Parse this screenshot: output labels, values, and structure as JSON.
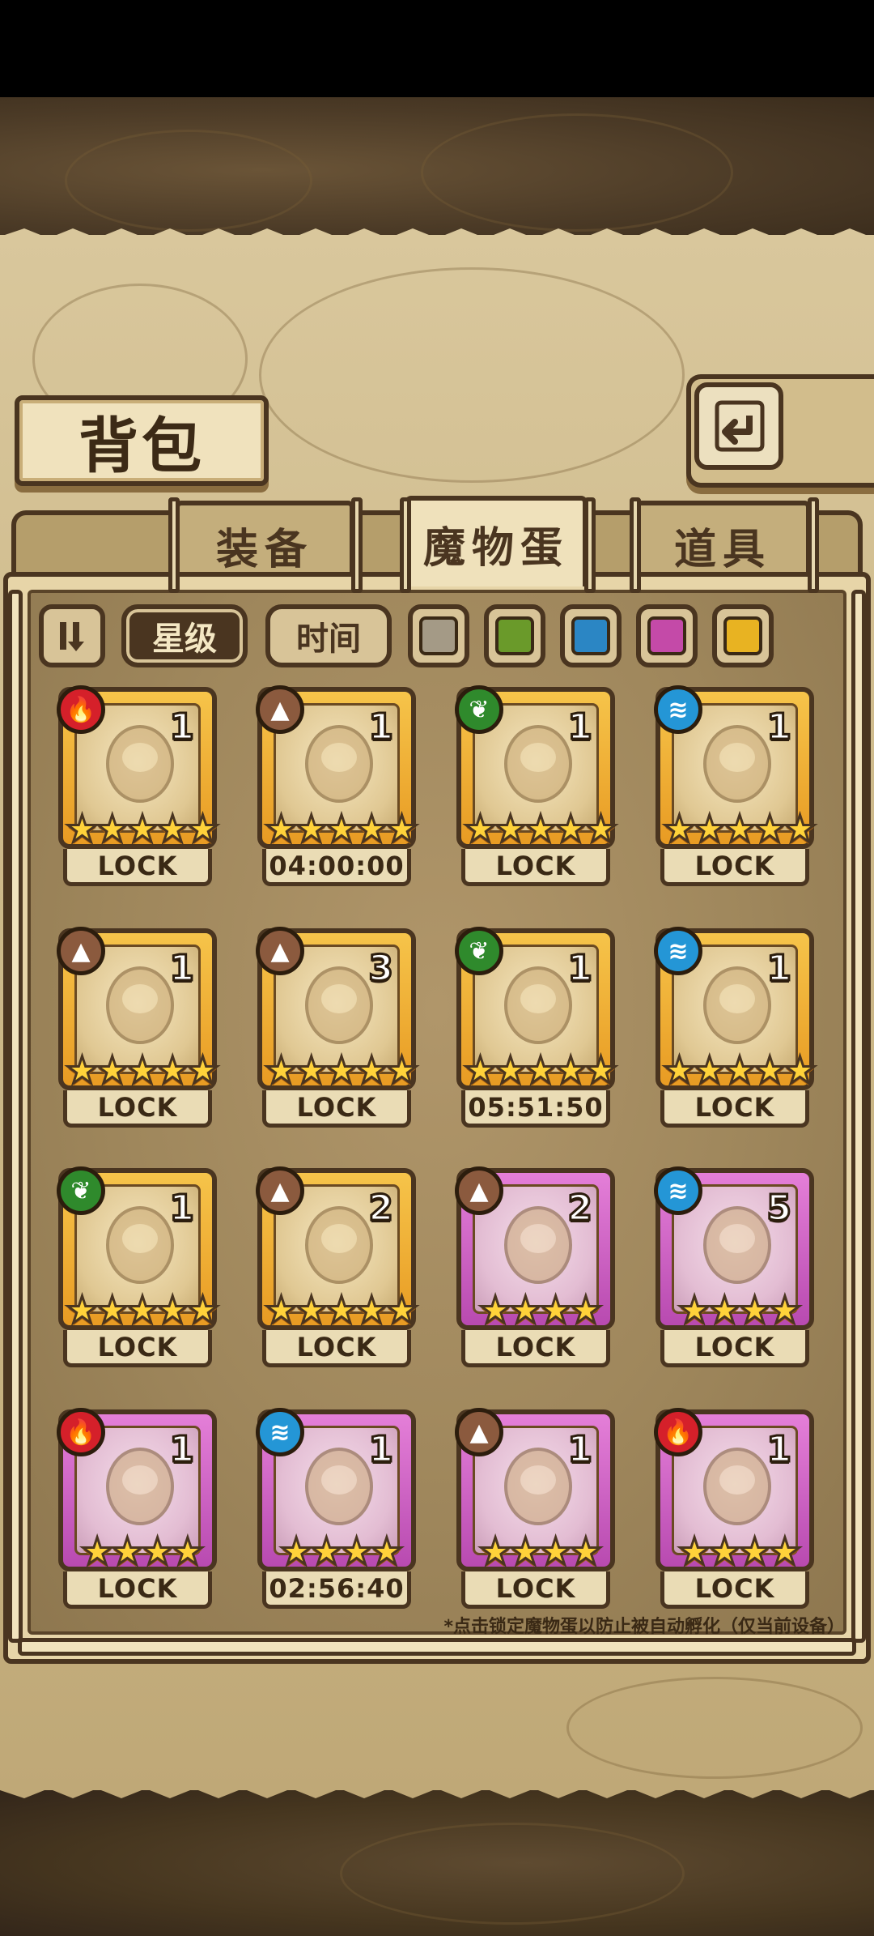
{
  "title": "背包",
  "tabs": [
    {
      "label": "装备",
      "active": false
    },
    {
      "label": "魔物蛋",
      "active": true
    },
    {
      "label": "道具",
      "active": false
    }
  ],
  "filters": {
    "sort_icon": "sort-toggle-icon",
    "star_label": "星级",
    "time_label": "时间",
    "colors": [
      "#a49a86",
      "#6a9a2a",
      "#2b86c4",
      "#c44aa8",
      "#e8b322"
    ]
  },
  "eggs": [
    {
      "element": "fire",
      "count": "1",
      "stars": 5,
      "rarity": "gold",
      "status": "LOCK"
    },
    {
      "element": "earth",
      "count": "1",
      "stars": 5,
      "rarity": "gold",
      "status": "04:00:00"
    },
    {
      "element": "nature",
      "count": "1",
      "stars": 5,
      "rarity": "gold",
      "status": "LOCK"
    },
    {
      "element": "water",
      "count": "1",
      "stars": 5,
      "rarity": "gold",
      "status": "LOCK"
    },
    {
      "element": "earth",
      "count": "1",
      "stars": 5,
      "rarity": "gold",
      "status": "LOCK"
    },
    {
      "element": "earth",
      "count": "3",
      "stars": 5,
      "rarity": "gold",
      "status": "LOCK"
    },
    {
      "element": "nature",
      "count": "1",
      "stars": 5,
      "rarity": "gold",
      "status": "05:51:50"
    },
    {
      "element": "water",
      "count": "1",
      "stars": 5,
      "rarity": "gold",
      "status": "LOCK"
    },
    {
      "element": "nature",
      "count": "1",
      "stars": 5,
      "rarity": "gold",
      "status": "LOCK"
    },
    {
      "element": "earth",
      "count": "2",
      "stars": 5,
      "rarity": "gold",
      "status": "LOCK"
    },
    {
      "element": "earth",
      "count": "2",
      "stars": 4,
      "rarity": "purple",
      "status": "LOCK"
    },
    {
      "element": "water",
      "count": "5",
      "stars": 4,
      "rarity": "purple",
      "status": "LOCK"
    },
    {
      "element": "fire",
      "count": "1",
      "stars": 4,
      "rarity": "purple",
      "status": "LOCK"
    },
    {
      "element": "water",
      "count": "1",
      "stars": 4,
      "rarity": "purple",
      "status": "02:56:40"
    },
    {
      "element": "earth",
      "count": "1",
      "stars": 4,
      "rarity": "purple",
      "status": "LOCK"
    },
    {
      "element": "fire",
      "count": "1",
      "stars": 4,
      "rarity": "purple",
      "status": "LOCK"
    }
  ],
  "note": "*点击锁定魔物蛋以防止被自动孵化（仅当前设备）"
}
